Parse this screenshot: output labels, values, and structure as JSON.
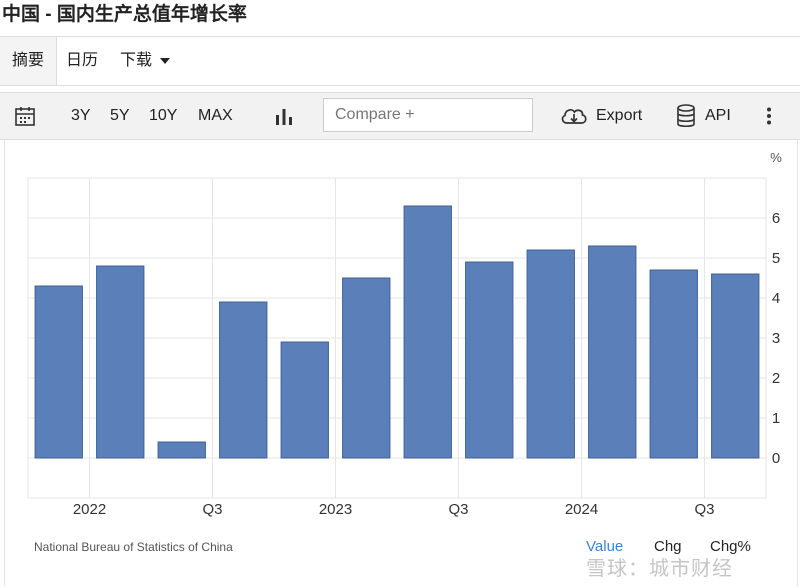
{
  "page": {
    "title": "中国 - 国内生产总值年增长率"
  },
  "tabs": [
    {
      "label": "摘要"
    },
    {
      "label": "日历"
    },
    {
      "label": "下载"
    }
  ],
  "toolbar": {
    "calendar_icon": "calendar-icon",
    "ranges": [
      "3Y",
      "5Y",
      "10Y",
      "MAX"
    ],
    "chart_type_icon": "bar-chart-icon",
    "compare_placeholder": "Compare +",
    "export_label": "Export",
    "export_icon": "cloud-download-icon",
    "api_label": "API",
    "api_icon": "database-icon",
    "more_icon": "more-vertical-icon"
  },
  "chart_data": {
    "type": "bar",
    "unit": "%",
    "x_tick_labels": [
      "2022",
      "Q3",
      "2023",
      "Q3",
      "2024",
      "Q3"
    ],
    "values": [
      4.3,
      4.8,
      0.4,
      3.9,
      2.9,
      4.5,
      6.3,
      4.9,
      5.2,
      5.3,
      4.7,
      4.6
    ],
    "ylim": [
      -1,
      7
    ],
    "y_ticks": [
      0,
      1,
      2,
      3,
      4,
      5,
      6
    ],
    "grid": true,
    "color": "#5b7fb9"
  },
  "footer": {
    "source": "National Bureau of Statistics of China",
    "view_value": "Value",
    "view_chg": "Chg",
    "view_chg_pct": "Chg%",
    "watermark": "雪球：城市财经"
  }
}
